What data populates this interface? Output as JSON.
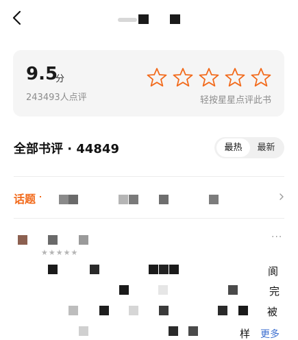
{
  "rating": {
    "score": "9.5",
    "unit": "分",
    "count_text": "243493人点评",
    "rate_hint": "轻按星星点评此书",
    "star_color": "#f26a1b"
  },
  "reviews_header": {
    "title": "全部书评 · 44849",
    "sort_options": [
      "最热",
      "最新"
    ]
  },
  "topic": {
    "label": "话题"
  },
  "review": {
    "stars": "★★★★★",
    "more_menu": "···",
    "glyphs": [
      "阆",
      "完",
      "被",
      "样",
      "更多"
    ]
  },
  "colors": {
    "accent": "#f26a1b",
    "link": "#3c6fd0",
    "card_bg": "#f5f5f5"
  }
}
